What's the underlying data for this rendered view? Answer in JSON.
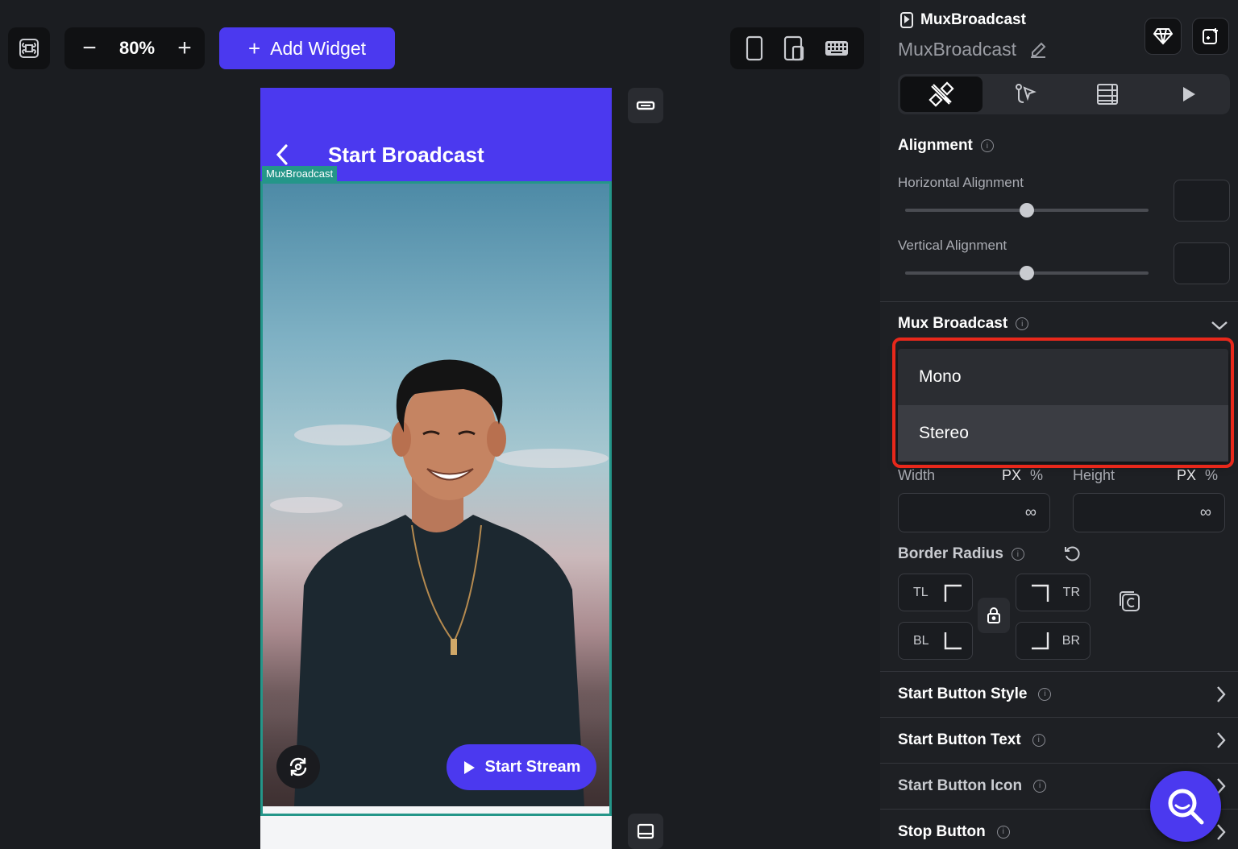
{
  "toolbar": {
    "zoom_minus": "−",
    "zoom_value": "80%",
    "zoom_plus": "+",
    "add_widget_label": "Add Widget",
    "add_widget_plus": "+"
  },
  "canvas": {
    "appbar_title": "Start Broadcast",
    "selected_widget_label": "MuxBroadcast",
    "start_stream_label": "Start Stream"
  },
  "panel": {
    "widget_type": "MuxBroadcast",
    "widget_name": "MuxBroadcast",
    "alignment_title": "Alignment",
    "horizontal_alignment_label": "Horizontal Alignment",
    "horizontal_alignment_value": 0.5,
    "vertical_alignment_label": "Vertical Alignment",
    "vertical_alignment_value": 0.5,
    "mux_broadcast_title": "Mux Broadcast",
    "dropdown_options": [
      "Mono",
      "Stereo"
    ],
    "width_label": "Width",
    "height_label": "Height",
    "unit_px": "PX",
    "unit_percent": "%",
    "width_value": "∞",
    "height_value": "∞",
    "border_radius_title": "Border Radius",
    "corners": {
      "tl": "TL",
      "tr": "TR",
      "bl": "BL",
      "br": "BR"
    },
    "rows": [
      "Start Button Style",
      "Start Button Text",
      "Start Button Icon",
      "Stop Button"
    ]
  },
  "colors": {
    "accent": "#4b39ef",
    "selection": "#249689",
    "highlight": "#e8281b"
  }
}
